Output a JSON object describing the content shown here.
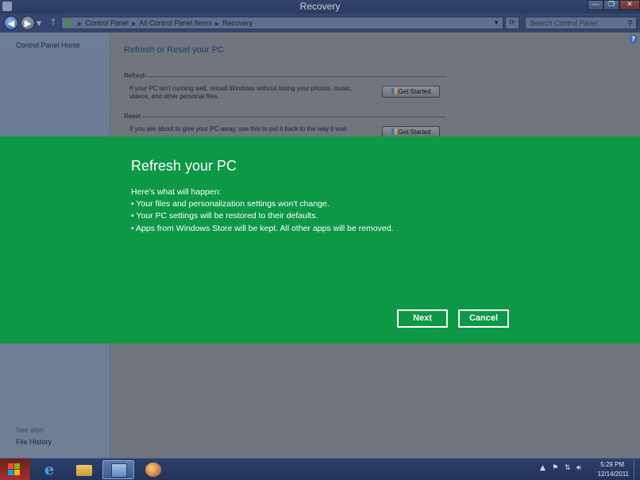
{
  "window": {
    "title": "Recovery",
    "minimize_glyph": "—",
    "restore_glyph": "❐",
    "close_glyph": "✕"
  },
  "navigation": {
    "breadcrumb": [
      "Control Panel",
      "All Control Panel Items",
      "Recovery"
    ],
    "search_placeholder": "Search Control Panel"
  },
  "sidebar": {
    "home_link": "Control Panel Home",
    "see_also_label": "See also",
    "file_history_link": "File History"
  },
  "main": {
    "page_title": "Refresh or Reset your PC",
    "refresh_section": {
      "label": "Refresh",
      "description": "If your PC isn't running well, reload Windows without losing your photos, music, videos, and other personal files.",
      "button_label": "Get Started"
    },
    "reset_section": {
      "label": "Reset",
      "description": "If you are about to give your PC away, use this to put it back to the way it was",
      "button_label": "Get Started"
    }
  },
  "overlay": {
    "title": "Refresh your PC",
    "intro": "Here's what will happen:",
    "bullets": [
      "• Your files and personalization settings won't change.",
      "• Your PC settings will be restored to their defaults.",
      "• Apps from Windows Store will be kept. All other apps will be removed."
    ],
    "next_label": "Next",
    "cancel_label": "Cancel",
    "background_color": "#0d9846"
  },
  "taskbar": {
    "apps": [
      "internet-explorer-icon",
      "file-explorer-icon",
      "control-panel-icon",
      "paint-icon"
    ],
    "clock_time": "5:29 PM",
    "clock_date": "12/14/2011"
  }
}
